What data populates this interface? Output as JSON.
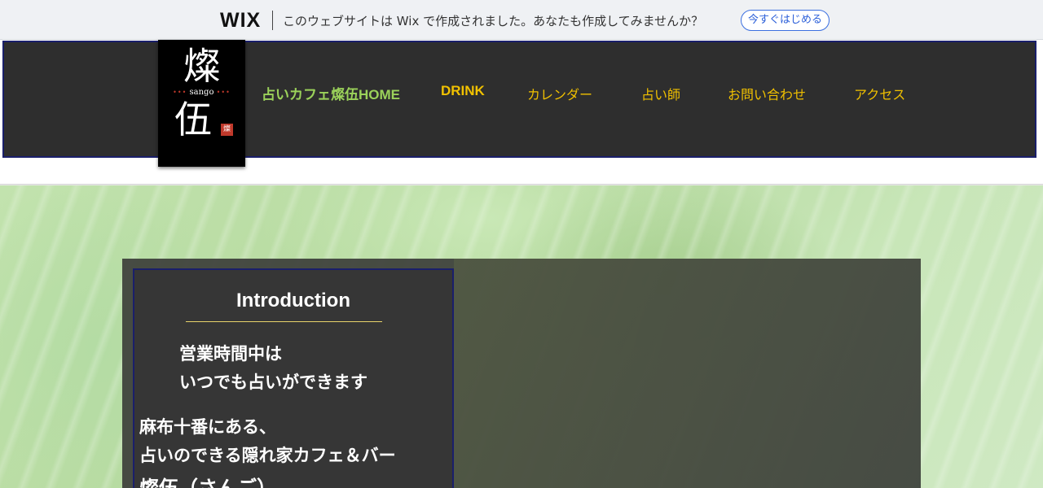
{
  "wix_banner": {
    "logo": "WIX",
    "message": "このウェブサイトは Wix で作成されました。あなたも作成してみませんか？",
    "cta": "今すぐはじめる"
  },
  "site": {
    "logo": {
      "top_glyph": "燦",
      "mid_text": "sango",
      "bottom_glyph": "伍",
      "seal": "燦"
    },
    "nav": [
      "占いカフェ燦伍HOME",
      "DRINK",
      "カレンダー",
      "占い師",
      "お問い合わせ",
      "アクセス"
    ]
  },
  "intro": {
    "title": "Introduction",
    "lines": [
      "営業時間中は",
      "いつでも占いができます",
      "麻布十番にある、",
      "占いのできる隠れ家カフェ＆バー",
      "燦伍（さんご）"
    ]
  },
  "colors": {
    "header_bg": "#2e2e2e",
    "header_border": "#1a1f6b",
    "nav_home": "#9bd25a",
    "nav_item": "#f0c000",
    "intro_rule": "#e8d36a"
  }
}
